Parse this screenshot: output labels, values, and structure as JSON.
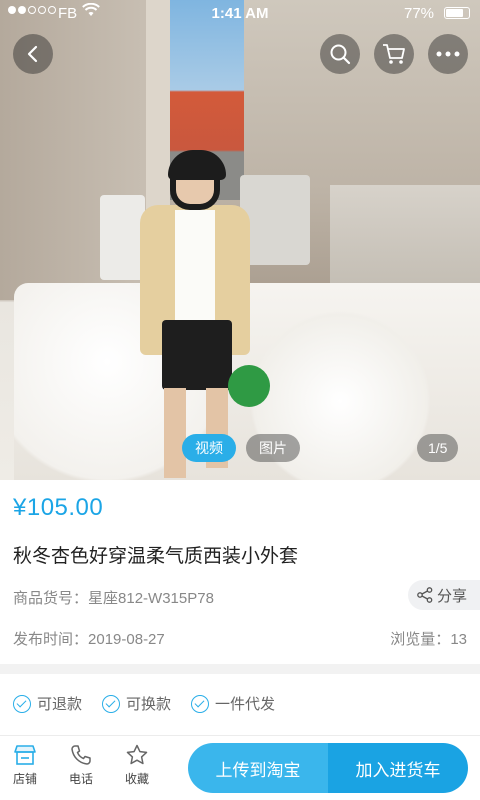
{
  "status_bar": {
    "carrier": "FB",
    "time": "1:41 AM",
    "battery": "77%",
    "battery_level": 0.77,
    "signal_bars": 2,
    "signal_total": 5
  },
  "nav": {
    "back_icon": "chevron-left-icon",
    "search_icon": "search-icon",
    "cart_icon": "cart-icon",
    "more_icon": "more-icon"
  },
  "gallery": {
    "tabs": [
      {
        "label": "视频",
        "active": true
      },
      {
        "label": "图片",
        "active": false
      }
    ],
    "counter": "1/5"
  },
  "product": {
    "price": "¥105.00",
    "title": "秋冬杏色好穿温柔气质西装小外套",
    "sku_label": "商品货号：",
    "sku_value": "星座812-W315P78",
    "share_label": "分享",
    "date_label": "发布时间：",
    "date_value": "2019-08-27",
    "views_label": "浏览量：",
    "views_value": "13"
  },
  "services": [
    {
      "label": "可退款"
    },
    {
      "label": "可换款"
    },
    {
      "label": "一件代发"
    }
  ],
  "bottom_bar": {
    "store_label": "店铺",
    "phone_label": "电话",
    "favorite_label": "收藏",
    "upload_label": "上传到淘宝",
    "add_cart_label": "加入进货车"
  },
  "colors": {
    "accent": "#1ba5e6",
    "upload_button": "#3ab6ec",
    "cart_button": "#1aa3e3"
  }
}
